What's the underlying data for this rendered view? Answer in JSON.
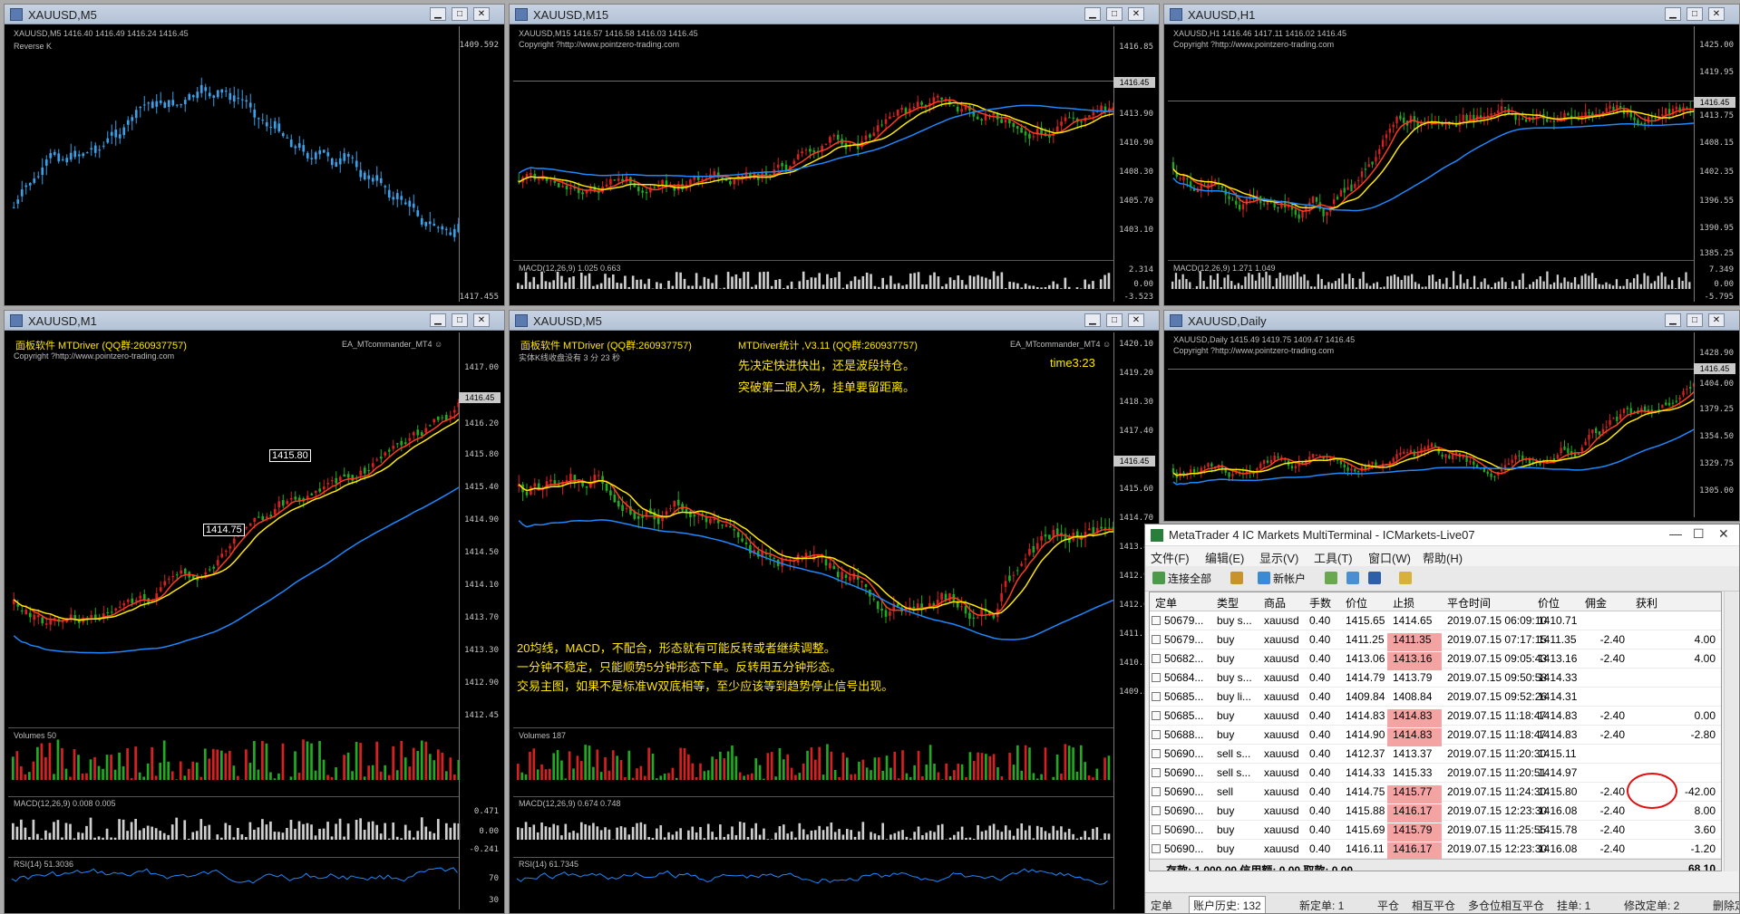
{
  "windows": [
    {
      "id": "w1",
      "title": "XAUUSD,M5",
      "header": "XAUUSD,M5  1416.40 1416.49 1416.24 1416.45",
      "sub": "Reverse K",
      "ticks": [
        "1409.592",
        "1417.455"
      ]
    },
    {
      "id": "w2",
      "title": "XAUUSD,M15",
      "header": "XAUUSD,M15  1416.57 1416.58 1416.03 1416.45",
      "sub": "Copyright ?http://www.pointzero-trading.com",
      "ticks": [
        "1416.85",
        "1413.90",
        "1410.90",
        "1408.30",
        "1405.70",
        "1403.10",
        "1400.50"
      ],
      "price_label": "1416.45",
      "macd": "MACD(12,26,9) 1.025 0.663",
      "macd_ticks": [
        "2.314",
        "0.00",
        "-3.523"
      ]
    },
    {
      "id": "w3",
      "title": "XAUUSD,H1",
      "header": "XAUUSD,H1  1416.46 1417.11 1416.02 1416.45",
      "sub": "Copyright ?http://www.pointzero-trading.com",
      "ticks": [
        "1425.00",
        "1419.95",
        "1416.45",
        "1413.75",
        "1408.15",
        "1402.35",
        "1396.55",
        "1390.95",
        "1385.25"
      ],
      "price_label": "1416.45",
      "macd": "MACD(12,26,9) 1.271 1.049",
      "macd_ticks": [
        "7.349",
        "0.00",
        "-5.795"
      ]
    },
    {
      "id": "w4",
      "title": "XAUUSD,M1",
      "header": "面板软件 MTDriver (QQ群:260937757)",
      "header2": "EA_MTcommander_MT4 ☺",
      "sub": "Copyright ?http://www.pointzero-trading.com",
      "ticks": [
        "1417.00",
        "1416.45",
        "1416.20",
        "1415.80",
        "1415.40",
        "1414.90",
        "1414.50",
        "1414.10",
        "1413.70",
        "1413.30",
        "1412.90",
        "1412.45"
      ],
      "price_label": "1416.45",
      "box1": "1415.80",
      "box2": "1414.75",
      "vol": "Volumes 50",
      "macd": "MACD(12,26,9) 0.008 0.005",
      "macd_ticks": [
        "0.471",
        "0.00",
        "-0.241"
      ],
      "rsi": "RSI(14) 51.3036",
      "rsi_ticks": [
        "70",
        "30"
      ]
    },
    {
      "id": "w5",
      "title": "XAUUSD,M5",
      "header": "面板软件 MTDriver (QQ群:260937757)",
      "header_b": "MTDriver统计 ,V3.11 (QQ群:260937757)",
      "header2": "EA_MTcommander_MT4 ☺",
      "sub": "实体K线收盘没有  3 分 23 秒",
      "ticks": [
        "1420.10",
        "1419.20",
        "1418.30",
        "1417.40",
        "1416.45",
        "1415.60",
        "1414.70",
        "1413.80",
        "1412.90",
        "1412.00",
        "1411.10",
        "1410.20",
        "1409.30"
      ],
      "price_label": "1416.45",
      "note1": "先决定快进快出，还是波段持仓。",
      "note2": "突破第二跟入场，挂单要留距离。",
      "time": "time3:23",
      "note3": "20均线，MACD，不配合，形态就有可能反转或者继续调整。",
      "note4": "一分钟不稳定，只能顺势5分钟形态下单。反转用五分钟形态。",
      "note5": "交易主图，如果不是标准W双底相等，至少应该等到趋势停止信号出现。",
      "vol": "Volumes 187",
      "macd": "MACD(12,26,9) 0.674 0.748",
      "rsi": "RSI(14) 61.7345"
    },
    {
      "id": "w6",
      "title": "XAUUSD,Daily",
      "header": "XAUUSD,Daily  1415.49 1419.75 1409.47 1416.45",
      "sub": "Copyright ?http://www.pointzero-trading.com",
      "ticks": [
        "1428.90",
        "1416.45",
        "1404.00",
        "1379.25",
        "1354.50",
        "1329.75",
        "1305.00"
      ],
      "price_label": "1416.45"
    }
  ],
  "terminal": {
    "title": "MetaTrader 4 IC Markets MultiTerminal - ICMarkets-Live07",
    "menu": [
      "文件(F)",
      "编辑(E)",
      "显示(V)",
      "工具(T)",
      "窗口(W)",
      "帮助(H)"
    ],
    "toolbar": [
      "连接全部",
      "新帐户"
    ],
    "columns": [
      "定单",
      "类型",
      "商品",
      "手数",
      "价位",
      "止损",
      "平仓时间",
      "价位",
      "佣金",
      "获利"
    ],
    "rows": [
      [
        "50679...",
        "buy s...",
        "xauusd",
        "0.40",
        "1415.65",
        "1414.65",
        "2019.07.15 06:09:10",
        "1410.71",
        "",
        ""
      ],
      [
        "50679...",
        "buy",
        "xauusd",
        "0.40",
        "1411.25",
        "1411.35",
        "2019.07.15 07:17:15",
        "1411.35",
        "-2.40",
        "4.00"
      ],
      [
        "50682...",
        "buy",
        "xauusd",
        "0.40",
        "1413.06",
        "1413.16",
        "2019.07.15 09:05:43",
        "1413.16",
        "-2.40",
        "4.00"
      ],
      [
        "50684...",
        "buy s...",
        "xauusd",
        "0.40",
        "1414.79",
        "1413.79",
        "2019.07.15 09:50:58",
        "1414.33",
        "",
        ""
      ],
      [
        "50685...",
        "buy li...",
        "xauusd",
        "0.40",
        "1409.84",
        "1408.84",
        "2019.07.15 09:52:26",
        "1414.31",
        "",
        ""
      ],
      [
        "50685...",
        "buy",
        "xauusd",
        "0.40",
        "1414.83",
        "1414.83",
        "2019.07.15 11:18:47",
        "1414.83",
        "-2.40",
        "0.00"
      ],
      [
        "50688...",
        "buy",
        "xauusd",
        "0.40",
        "1414.90",
        "1414.83",
        "2019.07.15 11:18:47",
        "1414.83",
        "-2.40",
        "-2.80"
      ],
      [
        "50690...",
        "sell s...",
        "xauusd",
        "0.40",
        "1412.37",
        "1413.37",
        "2019.07.15 11:20:30",
        "1415.11",
        "",
        ""
      ],
      [
        "50690...",
        "sell s...",
        "xauusd",
        "0.40",
        "1414.33",
        "1415.33",
        "2019.07.15 11:20:51",
        "1414.97",
        "",
        ""
      ],
      [
        "50690...",
        "sell",
        "xauusd",
        "0.40",
        "1414.75",
        "1415.77",
        "2019.07.15 11:24:30",
        "1415.80",
        "-2.40",
        "-42.00"
      ],
      [
        "50690...",
        "buy",
        "xauusd",
        "0.40",
        "1415.88",
        "1416.17",
        "2019.07.15 12:23:30",
        "1416.08",
        "-2.40",
        "8.00"
      ],
      [
        "50690...",
        "buy",
        "xauusd",
        "0.40",
        "1415.69",
        "1415.79",
        "2019.07.15 11:25:55",
        "1415.78",
        "-2.40",
        "3.60"
      ],
      [
        "50690...",
        "buy",
        "xauusd",
        "0.40",
        "1416.11",
        "1416.17",
        "2019.07.15 12:23:30",
        "1416.08",
        "-2.40",
        "-1.20"
      ]
    ],
    "red_sl": [
      1,
      2,
      5,
      6,
      9,
      10,
      11,
      12
    ],
    "footer": "存款: 1 000.00  信用额: 0.00  取款: 0.00",
    "footer_total": "68.10",
    "tabs": [
      "定单",
      "账户历史: 132",
      "新定单: 1",
      "平仓",
      "相互平仓",
      "多仓位相互平仓",
      "挂单: 1",
      "修改定单: 2",
      "删除定单"
    ]
  }
}
